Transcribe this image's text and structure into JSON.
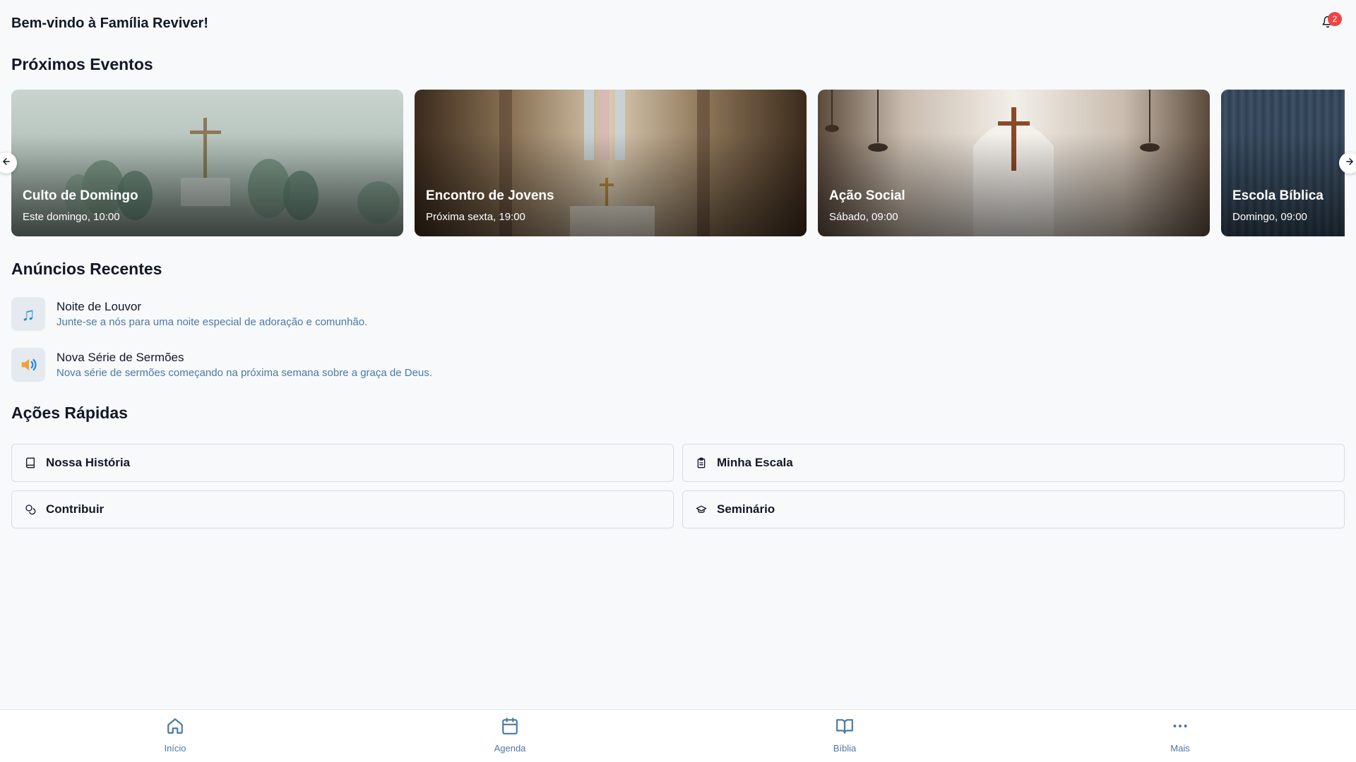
{
  "header": {
    "title": "Bem-vindo à Família Reviver!",
    "notification_count": "2"
  },
  "events": {
    "section_title": "Próximos Eventos",
    "items": [
      {
        "title": "Culto de Domingo",
        "time": "Este domingo, 10:00"
      },
      {
        "title": "Encontro de Jovens",
        "time": "Próxima sexta, 19:00"
      },
      {
        "title": "Ação Social",
        "time": "Sábado, 09:00"
      },
      {
        "title": "Escola Bíblica",
        "time": "Domingo, 09:00"
      }
    ]
  },
  "announcements": {
    "section_title": "Anúncios Recentes",
    "items": [
      {
        "icon": "music-notes-icon",
        "title": "Noite de Louvor",
        "description": "Junte-se a nós para uma noite especial de adoração e comunhão."
      },
      {
        "icon": "speaker-icon",
        "title": "Nova Série de Sermões",
        "description": "Nova série de sermões começando na próxima semana sobre a graça de Deus."
      }
    ]
  },
  "quick_actions": {
    "section_title": "Ações Rápidas",
    "items": [
      {
        "icon": "book-icon",
        "label": "Nossa História"
      },
      {
        "icon": "clipboard-icon",
        "label": "Minha Escala"
      },
      {
        "icon": "coins-icon",
        "label": "Contribuir"
      },
      {
        "icon": "graduation-cap-icon",
        "label": "Seminário"
      }
    ]
  },
  "bottom_nav": {
    "items": [
      {
        "icon": "home-icon",
        "label": "Início"
      },
      {
        "icon": "calendar-icon",
        "label": "Agenda"
      },
      {
        "icon": "open-book-icon",
        "label": "Bíblia"
      },
      {
        "icon": "more-icon",
        "label": "Mais"
      }
    ]
  }
}
